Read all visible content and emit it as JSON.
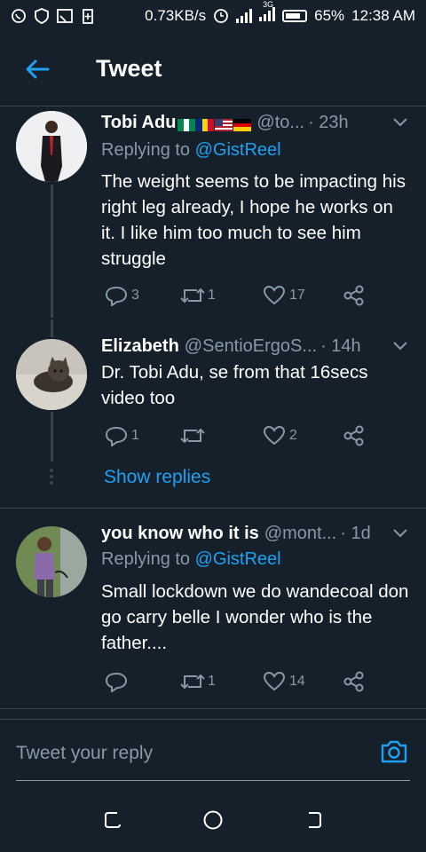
{
  "status_bar": {
    "speed": "0.73KB/s",
    "network_label": "3G",
    "battery": "65%",
    "time": "12:38 AM"
  },
  "header": {
    "title": "Tweet"
  },
  "tweets": [
    {
      "name": "Tobi Adu",
      "flags": [
        "Nigeria",
        "Romania",
        "United States",
        "Germany"
      ],
      "handle": "@to...",
      "time": "· 23h",
      "replying_prefix": "Replying to",
      "replying_to": "@GistReel",
      "text": "The weight seems to be impacting his right leg already, I hope he works on it. I like him too much to see him struggle",
      "replies": "3",
      "retweets": "1",
      "likes": "17"
    },
    {
      "name": "Elizabeth",
      "handle": "@SentioErgoS...",
      "time": "· 14h",
      "text": "Dr. Tobi Adu, se from that 16secs video too",
      "replies": "1",
      "retweets": "",
      "likes": "2"
    },
    {
      "name": "you know who it is",
      "handle": "@mont...",
      "time": "· 1d",
      "replying_prefix": "Replying to",
      "replying_to": "@GistReel",
      "text": "Small lockdown we do wandecoal don go carry belle I wonder who is the father....",
      "replies": "",
      "retweets": "1",
      "likes": "14"
    }
  ],
  "show_replies": "Show replies",
  "reply_bar": {
    "placeholder": "Tweet your reply"
  },
  "colors": {
    "background": "#15202b",
    "accent": "#1da1f2",
    "muted": "#8899a6",
    "divider": "#38444d"
  }
}
